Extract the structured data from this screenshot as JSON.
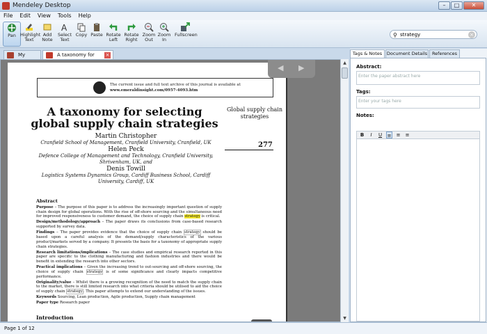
{
  "window": {
    "title": "Mendeley Desktop",
    "min": "–",
    "max": "□",
    "close": "✕"
  },
  "menu": [
    "File",
    "Edit",
    "View",
    "Tools",
    "Help"
  ],
  "toolbar": [
    {
      "label": "Pan",
      "icon": "pan-icon",
      "active": true
    },
    {
      "label": "Highlight Text",
      "icon": "highlighter-icon"
    },
    {
      "label": "Add Note",
      "icon": "note-icon"
    },
    {
      "label": "Select Text",
      "icon": "text-select-icon"
    },
    {
      "label": "Copy",
      "icon": "copy-icon"
    },
    {
      "label": "Paste",
      "icon": "paste-icon"
    },
    {
      "label": "Rotate Left",
      "icon": "rotate-left-icon"
    },
    {
      "label": "Rotate Right",
      "icon": "rotate-right-icon"
    },
    {
      "label": "Zoom Out",
      "icon": "zoom-out-icon"
    },
    {
      "label": "Zoom In",
      "icon": "zoom-in-icon"
    },
    {
      "label": "Fullscreen",
      "icon": "fullscreen-icon"
    }
  ],
  "search": {
    "value": "strategy"
  },
  "doc_tabs": [
    {
      "label": "My Library"
    },
    {
      "label": "A taxonomy for selecti..."
    }
  ],
  "paper": {
    "journal_notice_1": "The current issue and full text archive of this journal is available at",
    "journal_notice_2": "www.emeraldinsight.com/0957-4093.htm",
    "title": "A taxonomy for selecting global supply chain strategies",
    "side_journal": "Global supply chain strategies",
    "side_num": "277",
    "authors": [
      {
        "name": "Martin Christopher",
        "affil": "Cranfield School of Management, Cranfield University, Cranfield, UK"
      },
      {
        "name": "Helen Peck",
        "affil": "Defence College of Management and Technology, Cranfield University, Shrivenham, UK, and"
      },
      {
        "name": "Denis Towill",
        "affil": "Logistics Systems Dynamics Group, Cardiff Business School, Cardiff University, Cardiff, UK"
      }
    ],
    "abstract_heading": "Abstract",
    "purpose_label": "Purpose",
    "purpose_text": " – The purpose of this paper is to address the increasingly important question of supply chain design for global operations. With the rise of off-shore sourcing and the simultaneous need for improved responsiveness to customer demand, the choice of supply chain ",
    "purpose_hl": "strategy",
    "purpose_end": " is critical.",
    "design_label": "Design/methodology/approach",
    "design_text": " – The paper draws its conclusions from case-based research supported by survey data.",
    "findings_label": "Findings",
    "findings_text": " – The paper provides evidence that the choice of supply chain ",
    "findings_mk": "strategy",
    "findings_end": " should be based upon a careful analysis of the demand/supply characteristics of the various product/markets served by a company. It presents the basis for a taxonomy of appropriate supply chain strategies.",
    "limits_label": "Research limitations/implications",
    "limits_text": " – The case studies and empirical research reported in this paper are specific to the clothing manufacturing and fashion industries and there would be benefit in extending the research into other sectors.",
    "practical_label": "Practical implications",
    "practical_text": " – Given the increasing trend to out-sourcing and off-shore sourcing, the choice of supply chain ",
    "practical_mk": "strategy",
    "practical_end": " is of some significance and clearly impacts competitive performance.",
    "orig_label": "Originality/value",
    "orig_text": " – Whilst there is a growing recognition of the need to match the supply chain to the market, there is still limited research into what criteria should be utilised to aid the choice of supply chain ",
    "orig_mk": "strategy",
    "orig_end": ". This paper attempts to extend our understanding of the issues.",
    "keywords_label": "Keywords",
    "keywords_text": " Sourcing, Lean production, Agile production, Supply chain management",
    "ptype_label": "Paper type",
    "ptype_text": " Research paper",
    "intro": "Introduction"
  },
  "right_tabs": [
    "Tags & Notes",
    "Document Details",
    "References"
  ],
  "right_panel": {
    "abstract_label": "Abstract:",
    "abstract_placeholder": "Enter the paper abstract here",
    "tags_label": "Tags:",
    "tags_placeholder": "Enter your tags here",
    "notes_label": "Notes:"
  },
  "status": "Page 1 of 12"
}
